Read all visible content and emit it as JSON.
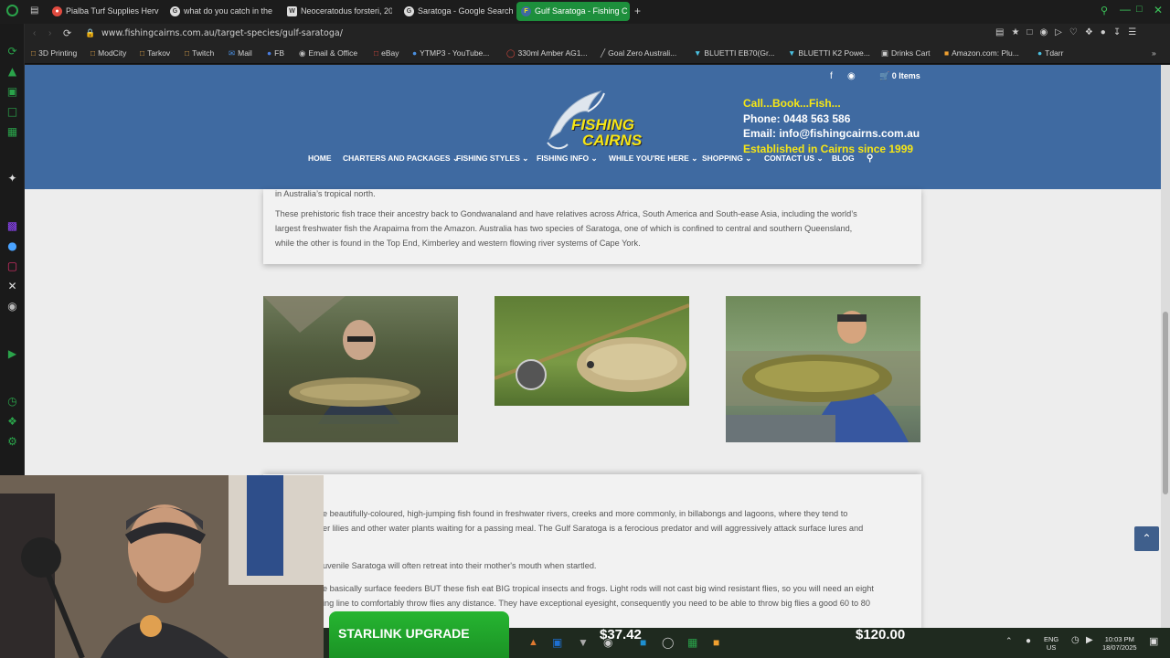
{
  "browser": {
    "tabs": [
      {
        "label": "Pialba Turf Supplies Herv",
        "icon": "map-pin-icon"
      },
      {
        "label": "what do you catch in the",
        "icon": "google-icon"
      },
      {
        "label": "Neoceratodus forsteri, 20",
        "icon": "wikipedia-icon"
      },
      {
        "label": "Saratoga - Google Search",
        "icon": "google-icon"
      },
      {
        "label": "Gulf Saratoga - Fishing C",
        "icon": "fishing-cairns-icon"
      }
    ],
    "new_tab": "+",
    "url": "www.fishingcairns.com.au/target-species/gulf-saratoga/",
    "bookmarks": [
      "3D Printing",
      "ModCity",
      "Tarkov",
      "Twitch",
      "Mail",
      "FB",
      "Email & Office",
      "eBay",
      "YTMP3 - YouTube...",
      "330ml Amber AG1...",
      "Goal Zero Australi...",
      "BLUETTI EB70(Gr...",
      "BLUETTI K2 Powe...",
      "Drinks Cart",
      "Amazon.com: Plu...",
      "Tdarr"
    ]
  },
  "site": {
    "logo_line1": "FISHING",
    "logo_line2": "CAIRNS",
    "cart": "0 Items",
    "contact": {
      "line1": "Call...Book...Fish...",
      "phone": "Phone: 0448 563 586",
      "email": "Email: info@fishingcairns.com.au",
      "established": "Established in Cairns since 1999"
    },
    "nav": [
      {
        "label": "HOME",
        "dropdown": false
      },
      {
        "label": "CHARTERS AND PACKAGES",
        "dropdown": true
      },
      {
        "label": "FISHING STYLES",
        "dropdown": true
      },
      {
        "label": "FISHING INFO",
        "dropdown": true
      },
      {
        "label": "WHILE YOU'RE HERE",
        "dropdown": true
      },
      {
        "label": "SHOPPING",
        "dropdown": true
      },
      {
        "label": "CONTACT US",
        "dropdown": true
      },
      {
        "label": "BLOG",
        "dropdown": false
      }
    ]
  },
  "article": {
    "line0": "in Australia’s tropical north.",
    "line1": "These prehistoric fish trace their ancestry back to Gondwanaland and have relatives across Africa, South America and South-ease Asia, including the world’s",
    "line2": "largest freshwater fish the Arapaima from the Amazon. Australia has two species of Saratoga, one of which is confined to central and southern Queensland,",
    "line3": "while the other is found in the Top End, Kimberley and western flowing river systems of Cape York."
  },
  "card2": {
    "line1": "e beautifully-coloured, high-jumping fish found in freshwater rivers, creeks and more commonly, in billabongs and lagoons, where they tend to",
    "line2": "er lilies and other water plants waiting for a passing meal. The Gulf Saratoga is a ferocious predator and will aggressively attack surface lures and",
    "line3": "uvenile Saratoga will often retreat into their mother's mouth when startled.",
    "line4": "e basically surface feeders BUT these fish eat BIG tropical insects and frogs. Light rods will not cast big wind resistant flies, so you will need an eight",
    "line5": "ing line to comfortably throw flies any distance. They have exceptional eyesight, consequently you need to be able to throw big flies a good 60 to 80"
  },
  "stream": {
    "donate_label": "STARLINK UPGRADE (!donate)",
    "current_amount": "$37.42",
    "goal_amount": "$120.00"
  },
  "taskbar": {
    "lang1": "ENG",
    "lang2": "US",
    "time": "10:03 PM",
    "date": "18/07/2025"
  }
}
